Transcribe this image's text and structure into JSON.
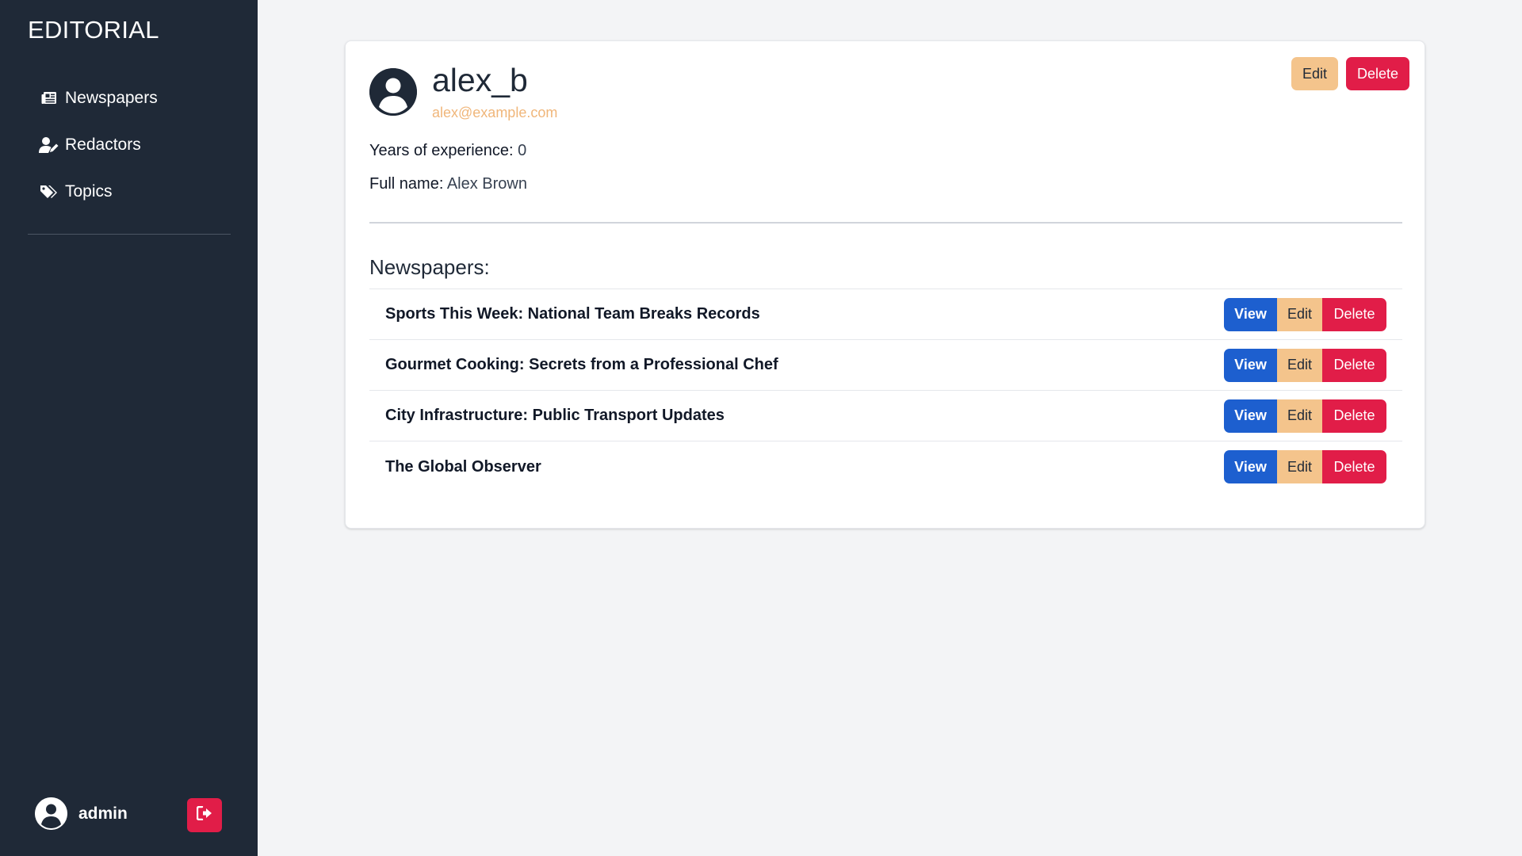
{
  "sidebar": {
    "brand": "EDITORIAL",
    "items": [
      {
        "label": "Newspapers",
        "icon": "newspaper-icon"
      },
      {
        "label": "Redactors",
        "icon": "user-edit-icon"
      },
      {
        "label": "Topics",
        "icon": "tags-icon"
      }
    ],
    "user": {
      "name": "admin",
      "icon": "user-circle-icon"
    },
    "logout_icon": "logout-icon"
  },
  "profile": {
    "username": "alex_b",
    "email": "alex@example.com",
    "edit_label": "Edit",
    "delete_label": "Delete",
    "experience_label": "Years of experience:",
    "experience_value": "0",
    "fullname_label": "Full name:",
    "fullname_value": "Alex Brown"
  },
  "newspapers": {
    "title": "Newspapers:",
    "view_label": "View",
    "edit_label": "Edit",
    "delete_label": "Delete",
    "items": [
      {
        "title": "Sports This Week: National Team Breaks Records"
      },
      {
        "title": "Gourmet Cooking: Secrets from a Professional Chef"
      },
      {
        "title": "City Infrastructure: Public Transport Updates"
      },
      {
        "title": "The Global Observer"
      }
    ]
  },
  "colors": {
    "sidebar_bg": "#1f2937",
    "accent_edit": "#f4c48c",
    "accent_delete": "#e11d48",
    "accent_view": "#1d5fcf",
    "email": "#f0b67a"
  }
}
